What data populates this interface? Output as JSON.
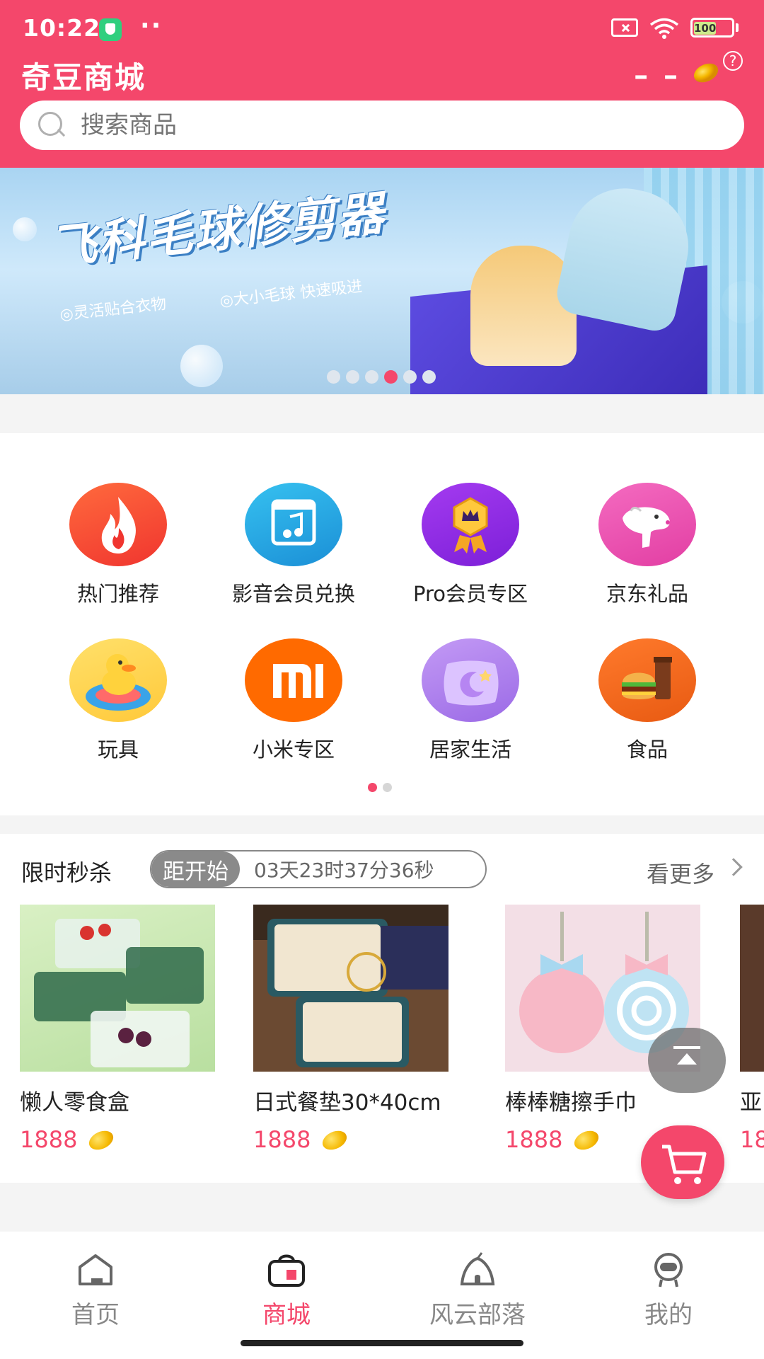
{
  "status_bar": {
    "time": "10:22",
    "battery": "100"
  },
  "header": {
    "title": "奇豆商城",
    "balance": "– –",
    "help_symbol": "?",
    "search_placeholder": "搜索商品"
  },
  "banner": {
    "title": "飞科毛球修剪器",
    "subtitle_1": "◎灵活贴合衣物",
    "subtitle_2": "◎大小毛球 快速吸进",
    "slide_count": 6,
    "active_slide": 4
  },
  "categories": {
    "items": [
      {
        "label": "热门推荐",
        "icon": "fire-icon"
      },
      {
        "label": "影音会员兑换",
        "icon": "music-film-icon"
      },
      {
        "label": "Pro会员专区",
        "icon": "crown-badge-icon"
      },
      {
        "label": "京东礼品",
        "icon": "jd-dog-icon"
      },
      {
        "label": "玩具",
        "icon": "duck-toy-icon"
      },
      {
        "label": "小米专区",
        "icon": "mi-logo-icon"
      },
      {
        "label": "居家生活",
        "icon": "pillow-moon-icon"
      },
      {
        "label": "食品",
        "icon": "burger-icon"
      }
    ],
    "page_count": 2,
    "active_page": 1
  },
  "flash_sale": {
    "title": "限时秒杀",
    "countdown_label": "距开始",
    "countdown_time": "03天23时37分36秒",
    "more_label": "看更多",
    "products": [
      {
        "name": "懒人零食盒",
        "price": "1888"
      },
      {
        "name": "日式餐垫30*40cm",
        "price": "1888"
      },
      {
        "name": "棒棒糖擦手巾",
        "price": "1888"
      },
      {
        "name": "亚",
        "price": "18"
      }
    ]
  },
  "bottom_nav": {
    "items": [
      {
        "label": "首页",
        "icon": "home-icon",
        "active": false
      },
      {
        "label": "商城",
        "icon": "shop-bag-icon",
        "active": true
      },
      {
        "label": "风云部落",
        "icon": "tribe-tent-icon",
        "active": false
      },
      {
        "label": "我的",
        "icon": "profile-icon",
        "active": false
      }
    ]
  },
  "colors": {
    "brand": "#f4476b",
    "countdown_gray": "#8a8a8a",
    "bean_gold": "#f5b800"
  }
}
